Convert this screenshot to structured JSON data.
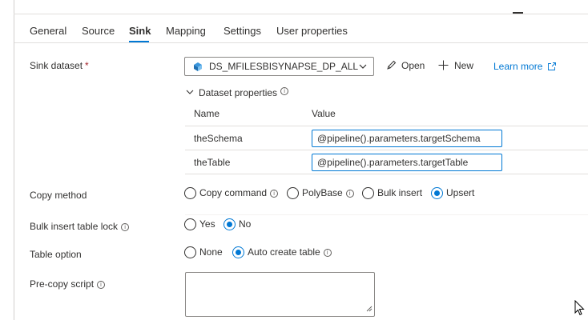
{
  "tabs": [
    {
      "label": "General"
    },
    {
      "label": "Source"
    },
    {
      "label": "Sink",
      "active": true
    },
    {
      "label": "Mapping"
    },
    {
      "label": "Settings"
    },
    {
      "label": "User properties"
    }
  ],
  "sink_dataset": {
    "label": "Sink dataset",
    "required_mark": "*",
    "selected": "DS_MFILESBISYNAPSE_DP_ALL",
    "open_label": "Open",
    "new_label": "New",
    "learn_more_label": "Learn more"
  },
  "dataset_properties": {
    "toggle_label": "Dataset properties",
    "columns": [
      "Name",
      "Value"
    ],
    "rows": [
      {
        "name": "theSchema",
        "value": "@pipeline().parameters.targetSchema"
      },
      {
        "name": "theTable",
        "value": "@pipeline().parameters.targetTable"
      }
    ]
  },
  "copy_method": {
    "label": "Copy method",
    "options": [
      "Copy command",
      "PolyBase",
      "Bulk insert",
      "Upsert"
    ],
    "selected": "Upsert"
  },
  "bulk_insert_lock": {
    "label": "Bulk insert table lock",
    "options": [
      "Yes",
      "No"
    ],
    "selected": "No"
  },
  "table_option": {
    "label": "Table option",
    "options": [
      "None",
      "Auto create table"
    ],
    "selected": "Auto create table"
  },
  "pre_copy_script": {
    "label": "Pre-copy script",
    "value": ""
  },
  "icons": {
    "info": "i",
    "dataset": "database-icon",
    "open": "pencil-icon",
    "new": "plus-icon",
    "external": "external-link-icon"
  },
  "colors": {
    "accent": "#0078d4",
    "required": "#a4262c",
    "dataset_icon": "#3a96dd"
  }
}
